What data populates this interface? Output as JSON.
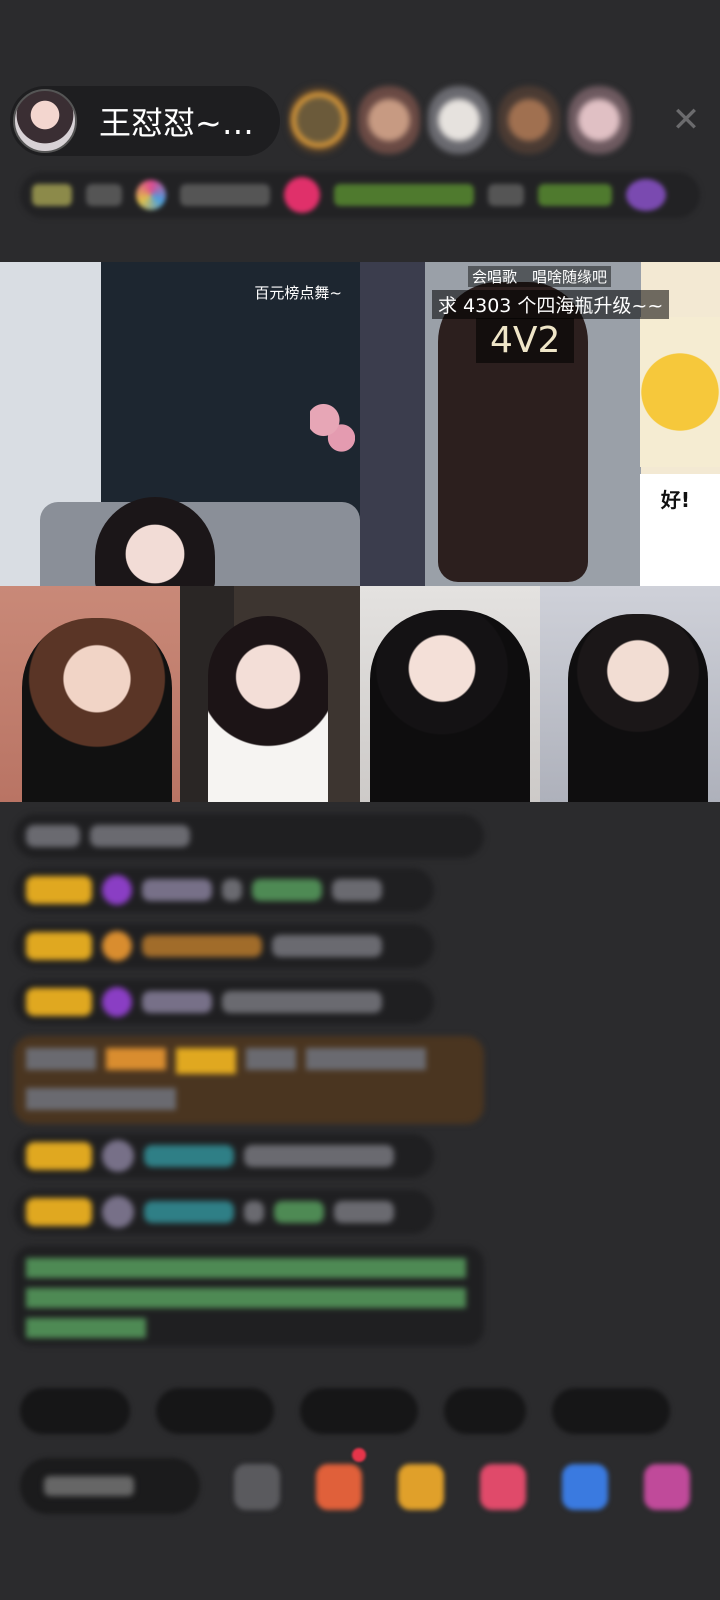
{
  "header": {
    "host_name": "王怼怼~…",
    "close_label": "✕"
  },
  "video": {
    "top_left_tag": "百元榜点舞~",
    "top_right_caption_line1": "会唱歌　唱啥随缘吧",
    "top_right_caption_line2": "求 4303 个四海瓶升级~~",
    "top_right_caption_line3": "4V2",
    "sticker_text": "好!"
  },
  "colors": {
    "background": "#2b2b2d",
    "pill": "#1e1e20",
    "badge_yellow": "#e0a820",
    "badge_purple": "#8a3ec4",
    "highlight_bubble": "#4a3520",
    "green_bubble_text": "#4e8a54"
  },
  "icons": {
    "close": "close-icon",
    "emoji": "emoji-icon",
    "gift_red": "gift-icon",
    "gift_gold": "treasure-icon",
    "heart": "heart-icon",
    "game": "game-icon",
    "more": "more-icon"
  }
}
